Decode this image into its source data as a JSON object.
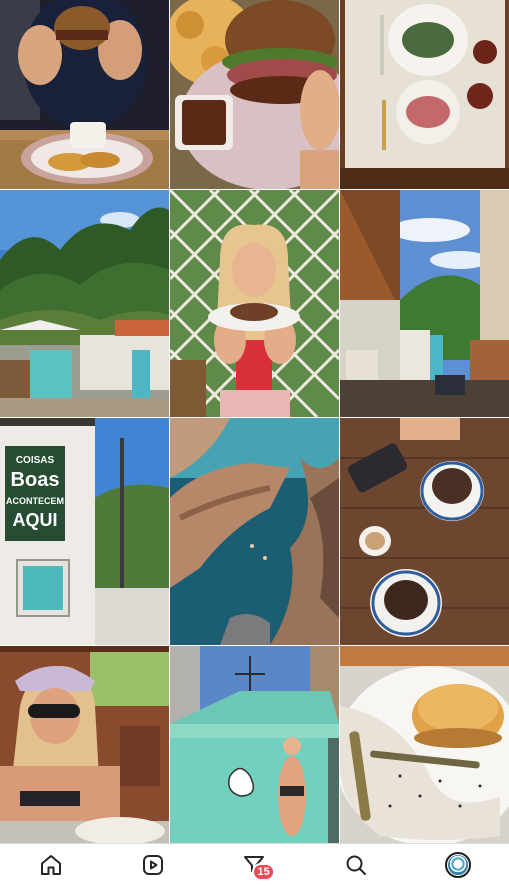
{
  "feed": {
    "tiles": [
      {
        "name": "burger-hands-photo"
      },
      {
        "name": "burger-closeup-photo"
      },
      {
        "name": "breakfast-table-photo"
      },
      {
        "name": "forest-hill-photo"
      },
      {
        "name": "woman-with-cake-photo"
      },
      {
        "name": "restaurant-street-photo"
      },
      {
        "name": "boas-sign-photo"
      },
      {
        "name": "rocky-coast-photo"
      },
      {
        "name": "acai-bowls-photo"
      },
      {
        "name": "woman-sunglasses-photo"
      },
      {
        "name": "beach-hut-photo"
      },
      {
        "name": "pancake-plate-photo"
      }
    ],
    "sign": {
      "line1": "COISAS",
      "line2": "Boas",
      "line3": "ACONTECEM",
      "line4": "AQUI"
    }
  },
  "nav": {
    "items": [
      {
        "icon": "home-icon"
      },
      {
        "icon": "reels-icon"
      },
      {
        "icon": "activity-icon",
        "badge": "15"
      },
      {
        "icon": "search-icon"
      },
      {
        "icon": "profile-avatar"
      }
    ],
    "badge_color": "#ed4956"
  }
}
